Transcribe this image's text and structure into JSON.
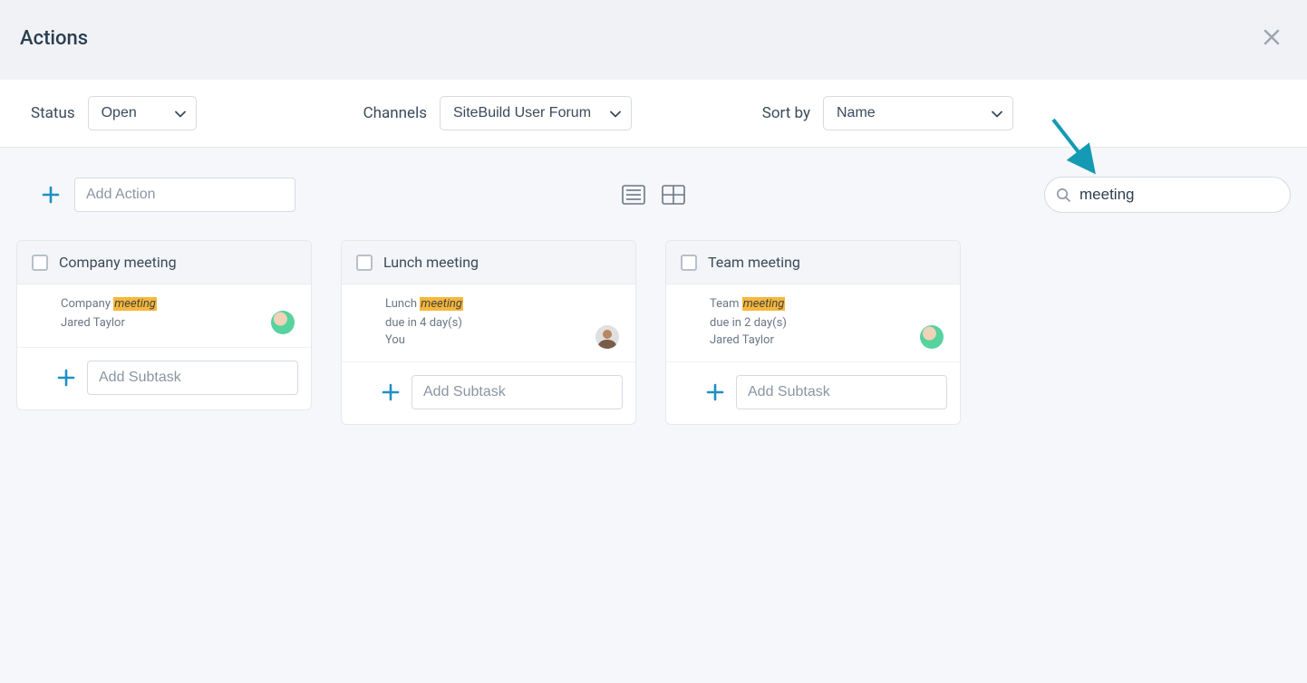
{
  "header": {
    "title": "Actions"
  },
  "filters": {
    "status_label": "Status",
    "status_value": "Open",
    "channels_label": "Channels",
    "channels_value": "SiteBuild User Forum",
    "sort_label": "Sort by",
    "sort_value": "Name"
  },
  "toolbar": {
    "add_action_placeholder": "Add Action",
    "search_value": "meeting"
  },
  "cards": [
    {
      "title": "Company meeting",
      "match_prefix": "Company ",
      "match_hl": "meeting",
      "due": "",
      "assignee": "Jared Taylor",
      "avatar": "green",
      "subtask_placeholder": "Add Subtask"
    },
    {
      "title": "Lunch meeting",
      "match_prefix": "Lunch ",
      "match_hl": "meeting",
      "due": "due in 4 day(s)",
      "assignee": "You",
      "avatar": "person",
      "subtask_placeholder": "Add Subtask"
    },
    {
      "title": "Team meeting",
      "match_prefix": "Team ",
      "match_hl": "meeting",
      "due": "due in 2 day(s)",
      "assignee": "Jared Taylor",
      "avatar": "green",
      "subtask_placeholder": "Add Subtask"
    }
  ]
}
